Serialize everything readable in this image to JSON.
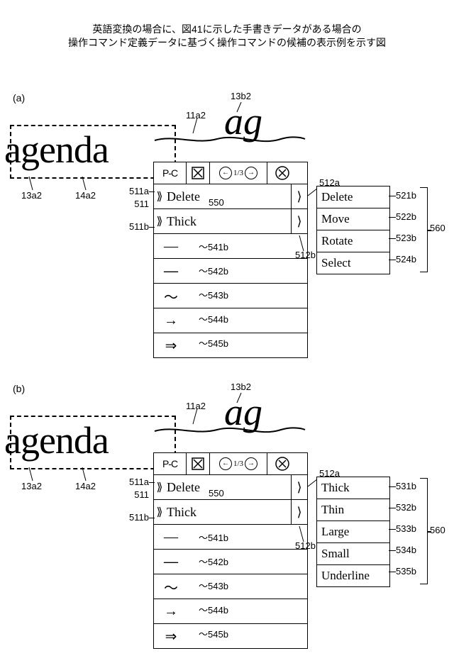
{
  "caption_line1": "英語変換の場合に、図41に示した手書きデータがある場合の",
  "caption_line2": "操作コマンド定義データに基づく操作コマンドの候補の表示例を示す図",
  "panels": {
    "a": {
      "label": "(a)"
    },
    "b": {
      "label": "(b)"
    }
  },
  "selection_word": "agenda",
  "handwritten": "ag",
  "header": {
    "pc": "P-C",
    "page": "1/3"
  },
  "commands": {
    "delete": "Delete",
    "thick": "Thick"
  },
  "secondary_a": {
    "r1": "Delete",
    "r2": "Move",
    "r3": "Rotate",
    "r4": "Select"
  },
  "secondary_b": {
    "r1": "Thick",
    "r2": "Thin",
    "r3": "Large",
    "r4": "Small",
    "r5": "Underline"
  },
  "refs": {
    "r13b2": "13b2",
    "r11a2": "11a2",
    "r13a2": "13a2",
    "r14a2": "14a2",
    "r511a": "511a",
    "r511": "511",
    "r511b": "511b",
    "r550": "550",
    "r512a": "512a",
    "r512b": "512b",
    "r541b": "541b",
    "r542b": "542b",
    "r543b": "543b",
    "r544b": "544b",
    "r545b": "545b",
    "r521b": "521b",
    "r522b": "522b",
    "r523b": "523b",
    "r524b": "524b",
    "r531b": "531b",
    "r532b": "532b",
    "r533b": "533b",
    "r534b": "534b",
    "r535b": "535b",
    "r560": "560"
  }
}
